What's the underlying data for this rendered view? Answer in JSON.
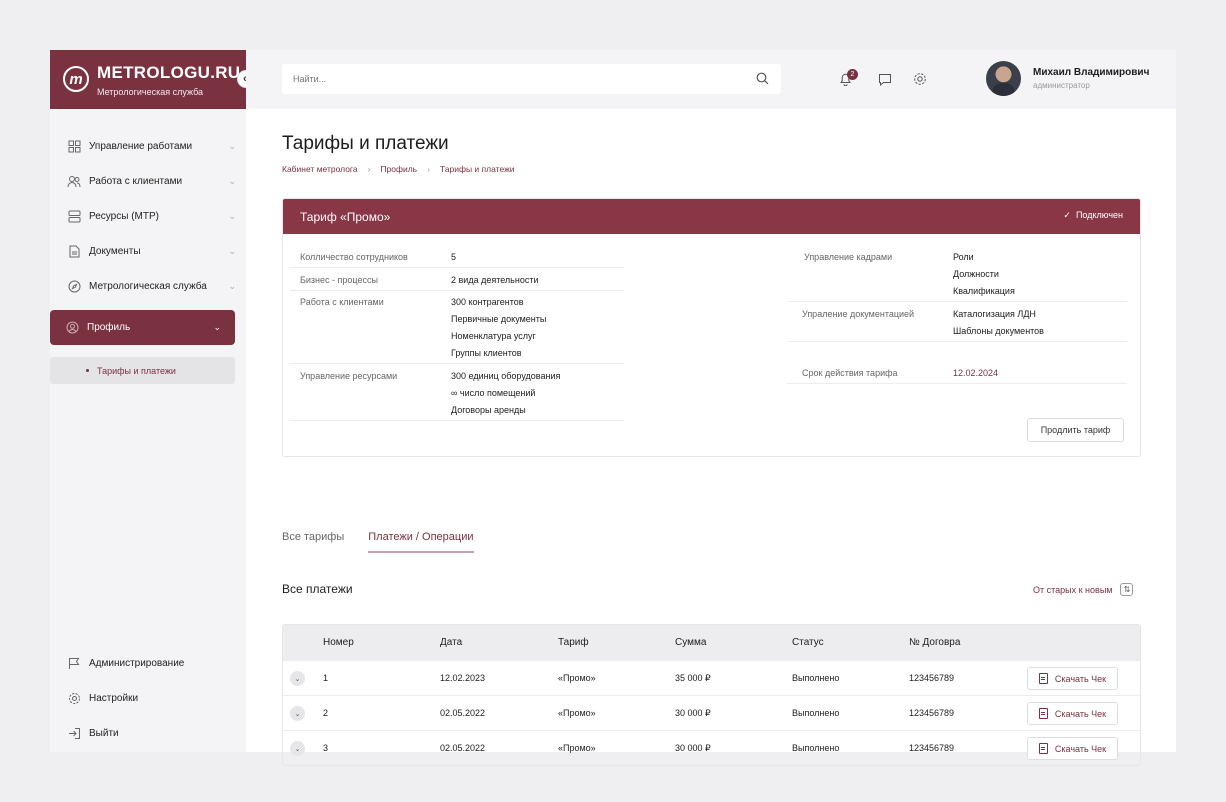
{
  "brand": {
    "name": "METROLOGU.RU",
    "subtitle": "Метрологическая служба",
    "logo_letter": "m"
  },
  "sidebar": {
    "collapse_icon": "«",
    "items": [
      {
        "label": "Управление работами",
        "icon": "grid-icon"
      },
      {
        "label": "Работа с клиентами",
        "icon": "users-icon"
      },
      {
        "label": "Ресурсы (МТР)",
        "icon": "server-icon"
      },
      {
        "label": "Документы",
        "icon": "document-icon"
      },
      {
        "label": "Метрологическая служба",
        "icon": "compass-icon"
      },
      {
        "label": "Профиль",
        "icon": "user-circle-icon",
        "active": true
      }
    ],
    "subitem": "Тарифы и платежи",
    "bottom": [
      {
        "label": "Администрирование",
        "icon": "flag-icon"
      },
      {
        "label": "Настройки",
        "icon": "gear-icon"
      },
      {
        "label": "Выйти",
        "icon": "logout-icon"
      }
    ]
  },
  "header": {
    "search_placeholder": "Найти...",
    "notifications_count": "2",
    "user_name": "Михаил Владимирович",
    "user_role": "администратор"
  },
  "page": {
    "title": "Тарифы и платежи",
    "breadcrumbs": [
      "Кабинет метролога",
      "Профиль",
      "Тарифы и платежи"
    ]
  },
  "tariff": {
    "name": "Тариф «Промо»",
    "status": "Подключен",
    "left": [
      {
        "key": "Колличество сотрудников",
        "values": [
          "5"
        ]
      },
      {
        "key": "Бизнес - процессы",
        "values": [
          "2 вида деятельности"
        ]
      },
      {
        "key": "Работа с клиентами",
        "values": [
          "300 контрагентов",
          "Первичные документы",
          "Номенклатура услуг",
          "Группы клиентов"
        ]
      },
      {
        "key": "Управление ресурсами",
        "values": [
          "300 единиц оборудования",
          "∞ число  помещений",
          "Договоры аренды"
        ]
      }
    ],
    "right": [
      {
        "key": "Управление кадрами",
        "values": [
          "Роли",
          "Должности",
          "Квалификация"
        ]
      },
      {
        "key": "Упраление документацией",
        "values": [
          "Каталогизация ЛДН",
          "Шаблоны документов"
        ]
      },
      {
        "key": "Срок действия тарифа",
        "values": [
          "12.02.2024"
        ]
      }
    ],
    "prolong_label": "Продлить тариф"
  },
  "tabs": [
    "Все тарифы",
    "Платежи / Операции"
  ],
  "payments": {
    "title": "Все платежи",
    "sort_label": "От старых к новым",
    "columns": [
      "Номер",
      "Дата",
      "Тариф",
      "Сумма",
      "Статус",
      "№ Договра"
    ],
    "download_label": "Скачать Чек",
    "rows": [
      [
        "1",
        "12.02.2023",
        "«Промо»",
        "35 000 ₽",
        "Выполнено",
        "123456789"
      ],
      [
        "2",
        "02.05.2022",
        "«Промо»",
        "30 000 ₽",
        "Выполнено",
        "123456789"
      ],
      [
        "3",
        "02.05.2022",
        "«Промо»",
        "30 000 ₽",
        "Выполнено",
        "123456789"
      ]
    ]
  },
  "colors": {
    "accent": "#7a3140",
    "header_bar": "#893647"
  }
}
